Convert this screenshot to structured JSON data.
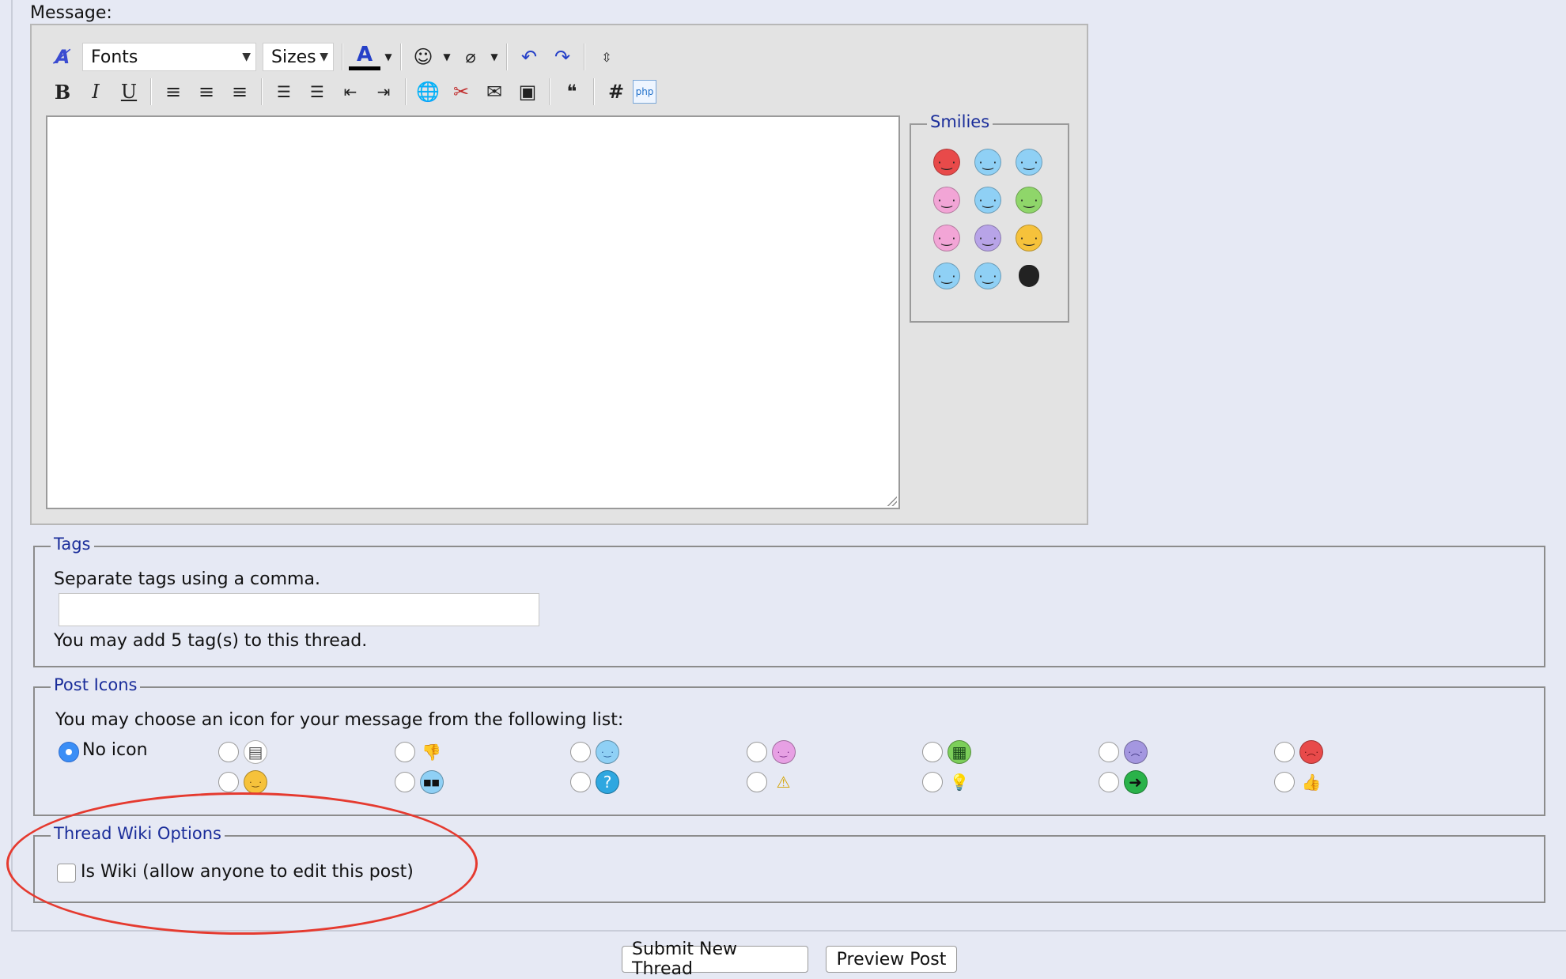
{
  "message": {
    "label": "Message:",
    "toolbar": {
      "fonts_label": "Fonts",
      "sizes_label": "Sizes"
    },
    "smilies_label": "Smilies",
    "smilies": [
      {
        "icon": "angry-smiley-icon",
        "color": "#e84a4a"
      },
      {
        "icon": "eyes-up-smiley-icon",
        "color": "#8fd0f5"
      },
      {
        "icon": "cool-smiley-icon",
        "color": "#8fd0f5"
      },
      {
        "icon": "tongue-smiley-icon",
        "color": "#f2a5d6"
      },
      {
        "icon": "wink-smiley-icon",
        "color": "#8fd0f5"
      },
      {
        "icon": "grin-smiley-icon",
        "color": "#8fd66a"
      },
      {
        "icon": "blush-smiley-icon",
        "color": "#f2a5d6"
      },
      {
        "icon": "sad-smiley-icon",
        "color": "#b8a4e8"
      },
      {
        "icon": "smile-smiley-icon",
        "color": "#f6c23b"
      },
      {
        "icon": "confused-smiley-icon",
        "color": "#8fd0f5"
      },
      {
        "icon": "surprised-smiley-icon",
        "color": "#8fd0f5"
      },
      {
        "icon": "apple-icon",
        "color": "#222222"
      }
    ]
  },
  "tags": {
    "legend": "Tags",
    "hint": "Separate tags using a comma.",
    "limit": "You may add 5 tag(s) to this thread."
  },
  "post_icons": {
    "legend": "Post Icons",
    "hint": "You may choose an icon for your message from the following list:",
    "no_icon_label": "No icon",
    "icons": [
      {
        "icon": "document-icon"
      },
      {
        "icon": "thumbs-down-icon"
      },
      {
        "icon": "wink-icon"
      },
      {
        "icon": "tongue-icon"
      },
      {
        "icon": "grin-icon"
      },
      {
        "icon": "sad-icon"
      },
      {
        "icon": "angry-icon"
      },
      {
        "icon": "smile-icon"
      },
      {
        "icon": "cool-icon"
      },
      {
        "icon": "question-icon"
      },
      {
        "icon": "warning-icon"
      },
      {
        "icon": "lightbulb-icon"
      },
      {
        "icon": "arrow-right-icon"
      },
      {
        "icon": "thumbs-up-icon"
      }
    ]
  },
  "wiki": {
    "legend": "Thread Wiki Options",
    "checkbox_label": "Is Wiki (allow anyone to edit this post)"
  },
  "buttons": {
    "submit": "Submit New Thread",
    "preview": "Preview Post"
  }
}
